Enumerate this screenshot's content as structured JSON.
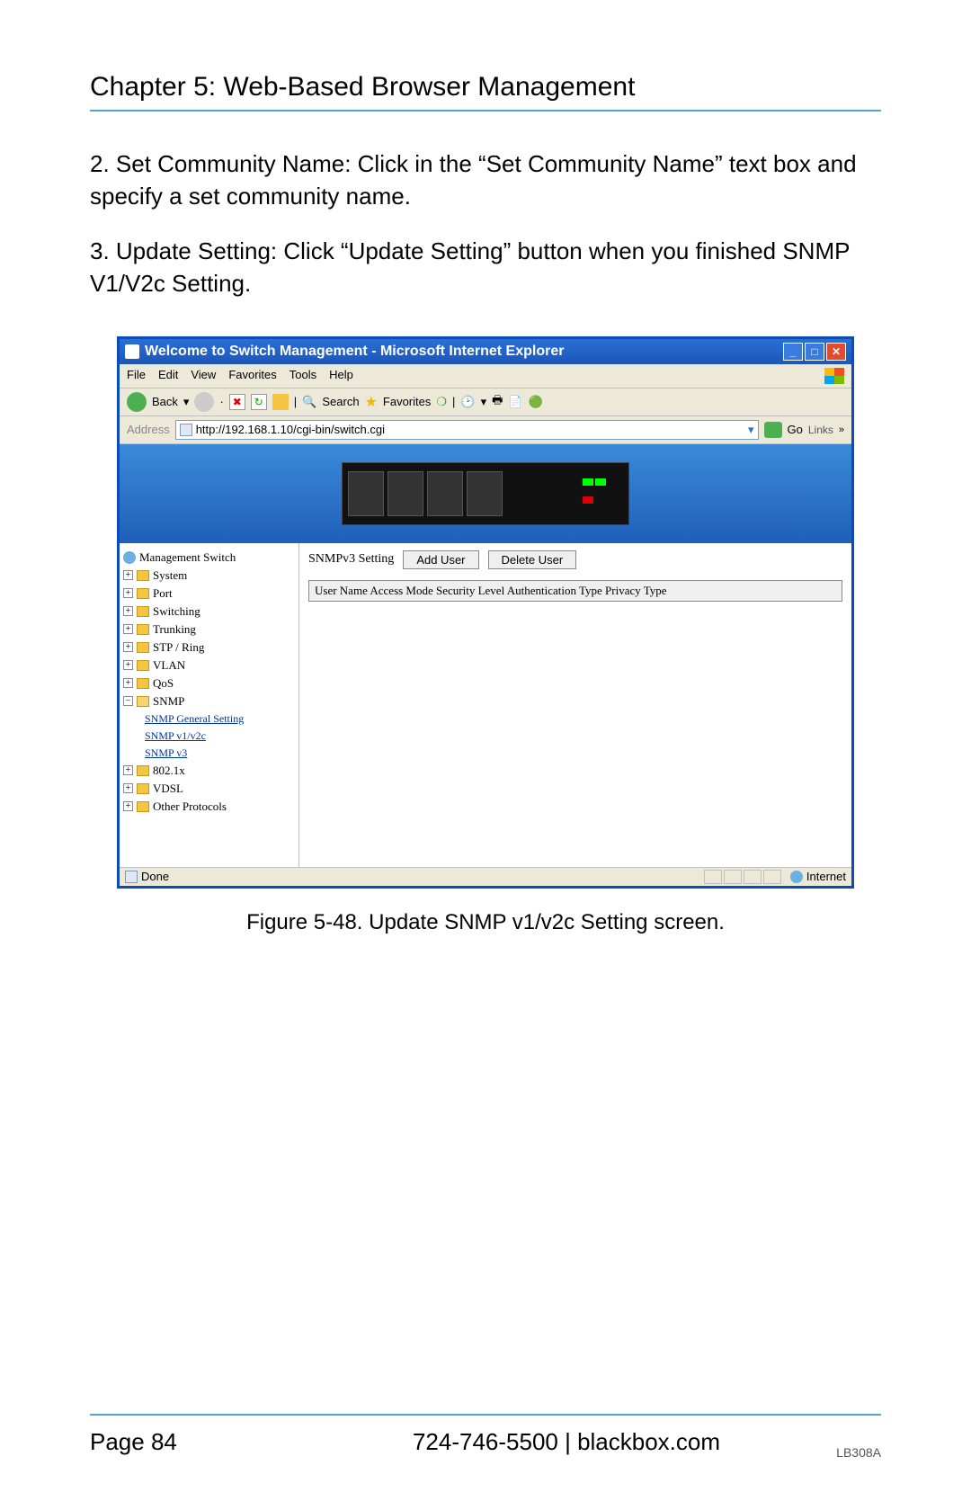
{
  "chapter_title": "Chapter 5: Web-Based Browser Management",
  "paragraphs": {
    "p1": "2. Set Community Name: Click in the “Set Community Name” text box and specify a set community name.",
    "p2": "3. Update Setting: Click “Update Setting” button when you finished SNMP V1/V2c Setting."
  },
  "window": {
    "title": "Welcome to Switch Management - Microsoft Internet Explorer",
    "menus": {
      "file": "File",
      "edit": "Edit",
      "view": "View",
      "favorites": "Favorites",
      "tools": "Tools",
      "help": "Help"
    },
    "toolbar": {
      "back": "Back",
      "search": "Search",
      "favorites": "Favorites"
    },
    "address_label": "Address",
    "address_url": "http://192.168.1.10/cgi-bin/switch.cgi",
    "go": "Go",
    "links": "Links",
    "status_done": "Done",
    "status_zone": "Internet"
  },
  "tree": {
    "root": "Management Switch",
    "items": [
      "System",
      "Port",
      "Switching",
      "Trunking",
      "STP / Ring",
      "VLAN",
      "QoS",
      "SNMP",
      "802.1x",
      "VDSL",
      "Other Protocols"
    ],
    "snmp_children": [
      "SNMP General Setting",
      "SNMP v1/v2c",
      "SNMP v3"
    ]
  },
  "panel": {
    "heading": "SNMPv3 Setting",
    "add_user": "Add User",
    "delete_user": "Delete User",
    "table_header": "User Name Access Mode Security Level Authentication Type Privacy Type"
  },
  "caption": "Figure 5-48. Update SNMP v1/v2c Setting screen.",
  "footer": {
    "page": "Page 84",
    "center": "724-746-5500   |   blackbox.com",
    "code": "LB308A"
  }
}
